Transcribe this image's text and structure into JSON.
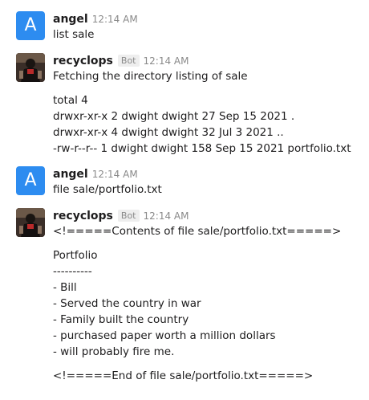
{
  "messages": [
    {
      "avatar_letter": "A",
      "author": "angel",
      "time": "12:14 AM",
      "lines": [
        "list sale"
      ]
    },
    {
      "author": "recyclops",
      "badge": "Bot",
      "time": "12:14 AM",
      "lines": [
        "Fetching the directory listing of sale",
        "total 4",
        "drwxr-xr-x 2 dwight dwight 27 Sep 15 2021 .",
        "drwxr-xr-x 4 dwight dwight 32 Jul 3 2021 ..",
        "-rw-r--r-- 1 dwight dwight 158 Sep 15 2021 portfolio.txt"
      ]
    },
    {
      "avatar_letter": "A",
      "author": "angel",
      "time": "12:14 AM",
      "lines": [
        "file sale/portfolio.txt"
      ]
    },
    {
      "author": "recyclops",
      "badge": "Bot",
      "time": "12:14 AM",
      "lines": [
        "<!=====Contents of file sale/portfolio.txt=====>",
        "Portfolio",
        "----------",
        "- Bill",
        "- Served the country in war",
        "- Family built the country",
        "- purchased paper worth a million dollars",
        "- will probably fire me.",
        "<!=====End of file sale/portfolio.txt=====>"
      ]
    }
  ],
  "colors": {
    "avatar_blue": "#2d8cf0",
    "text": "#1d1c1d",
    "muted": "#8a8a8a"
  }
}
